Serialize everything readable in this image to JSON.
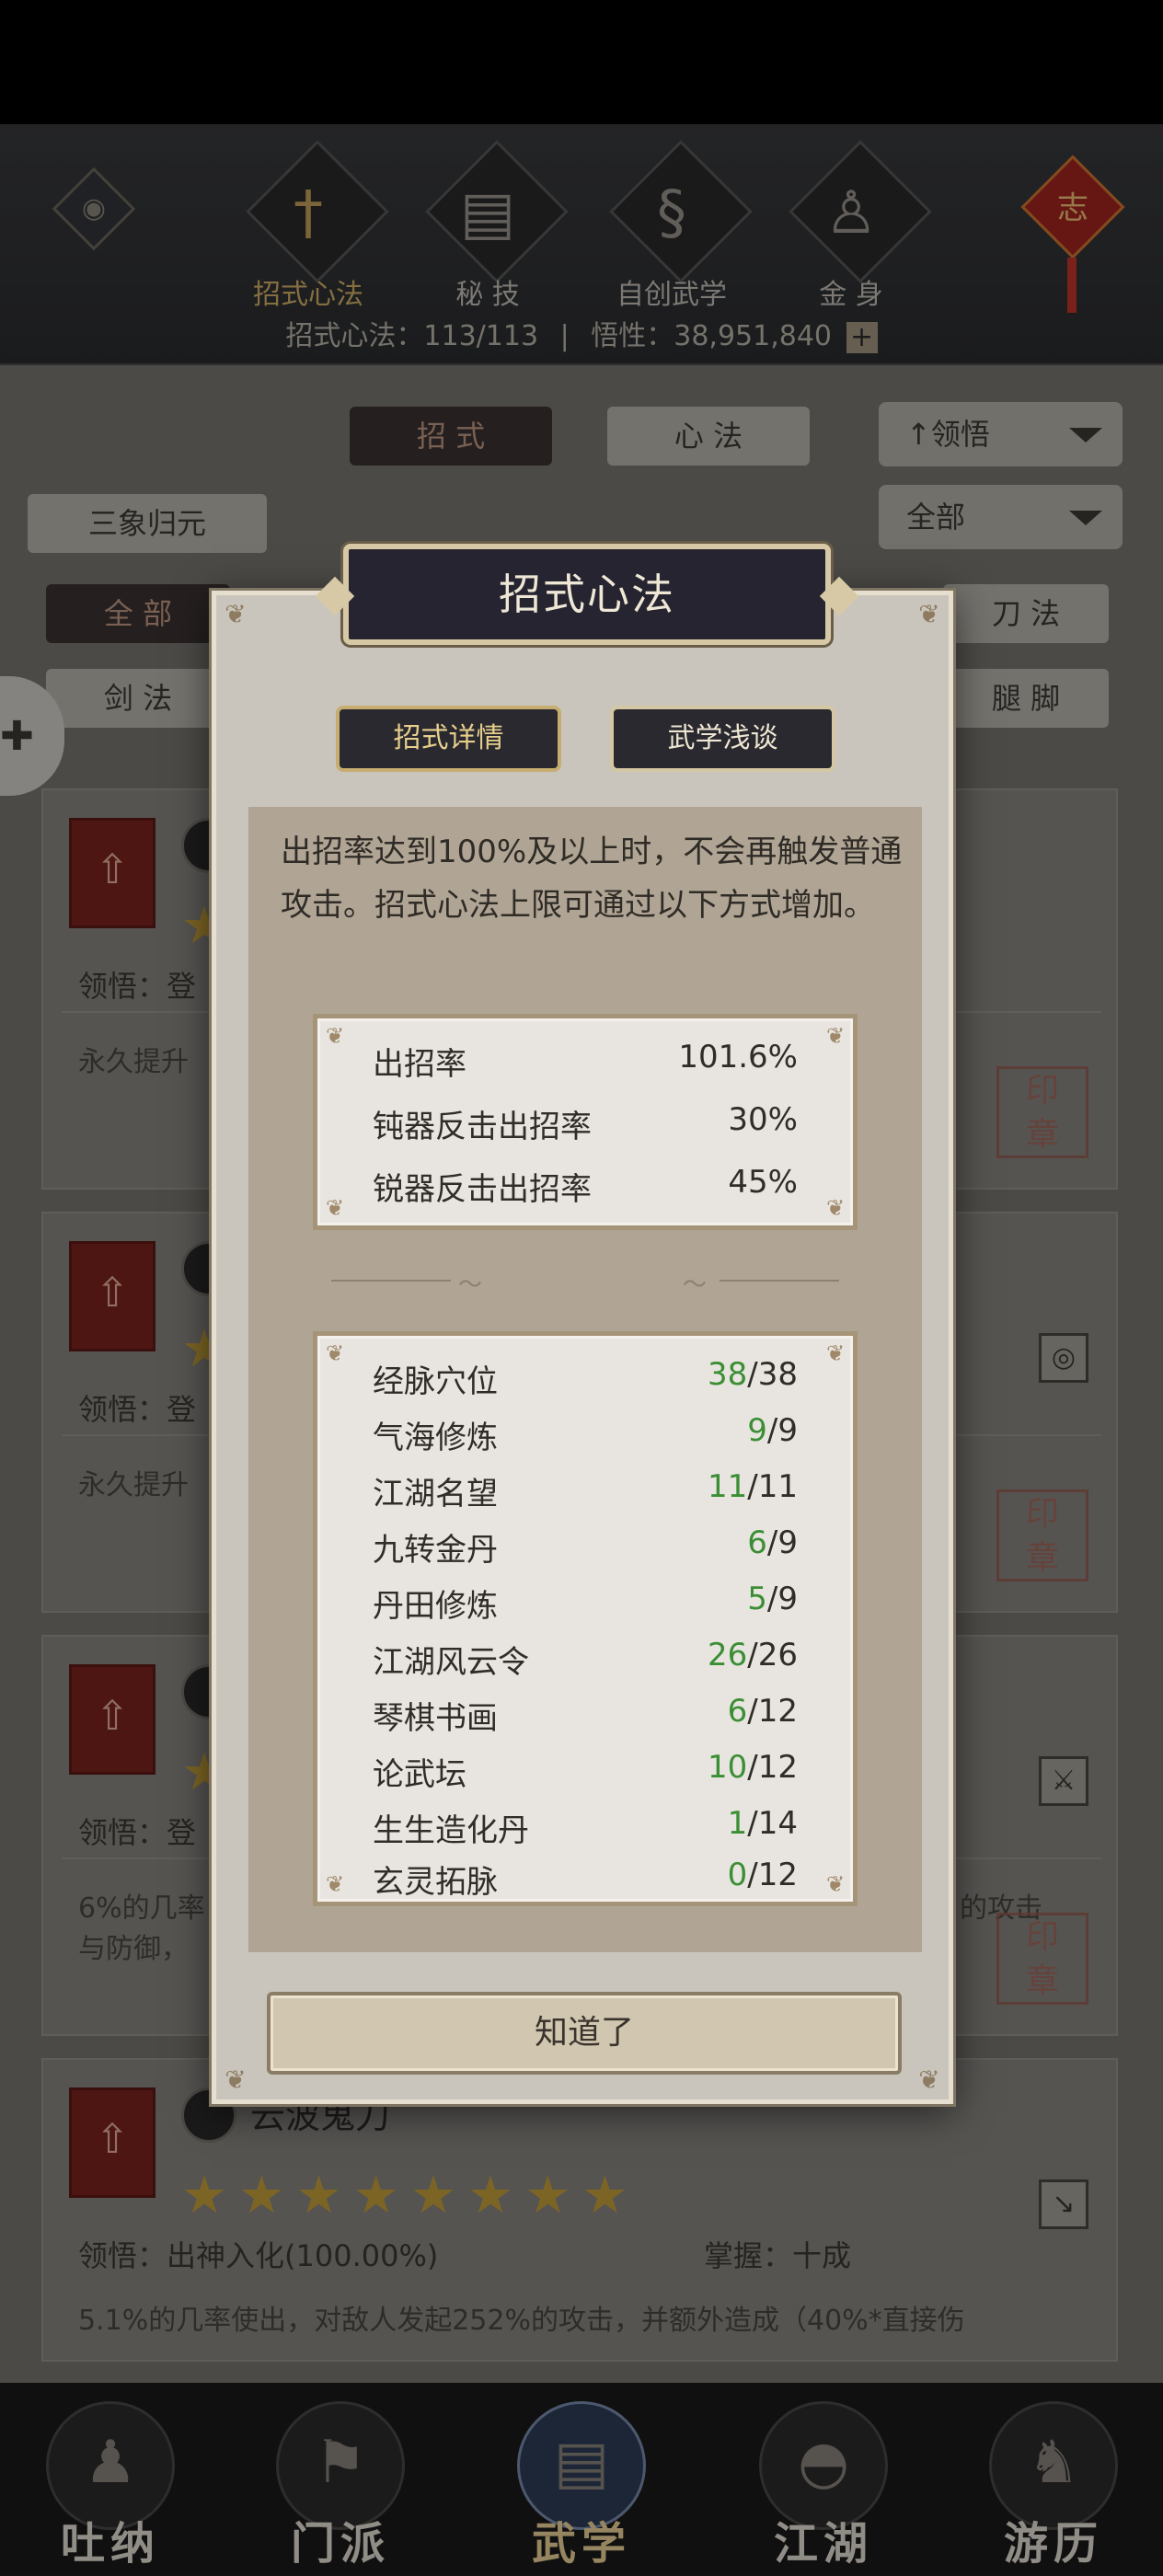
{
  "topnav": {
    "tabs": [
      {
        "label": "招式心法",
        "icon": "sword-icon"
      },
      {
        "label": "秘 技",
        "icon": "book-icon"
      },
      {
        "label": "自创武学",
        "icon": "scroll-icon"
      },
      {
        "label": "金 身",
        "icon": "meditation-icon"
      }
    ],
    "knot_text": "志",
    "stat_left": "招式心法：113/113",
    "stat_sep": "|",
    "stat_right": "悟性：38,951,840",
    "plus": "+"
  },
  "filters": {
    "tab_zhaoshi": "招 式",
    "tab_xinfa": "心 法",
    "sort_select": "领悟",
    "search_value": "三象归元",
    "category_select": "全部",
    "chips": [
      "全 部",
      "刀 法",
      "剑 法",
      "腿 脚"
    ]
  },
  "cards": [
    {
      "row_label": "领悟：登",
      "desc": "永久提升"
    },
    {
      "row_label": "领悟：登",
      "desc": "永久提升"
    },
    {
      "row_label": "领悟：登",
      "desc": "6%的几率",
      "desc2": "与防御，",
      "desc_right": "的攻击"
    },
    {
      "title": "云波鬼刀",
      "row_label": "领悟：出神入化(100.00%)",
      "row_right": "掌握：十成",
      "desc": "5.1%的几率使出，对敌人发起252%的攻击，并额外造成（40%*直接伤",
      "stars": 8
    }
  ],
  "bottombar": [
    {
      "label": "吐纳"
    },
    {
      "label": "门派"
    },
    {
      "label": "武学"
    },
    {
      "label": "江湖"
    },
    {
      "label": "游历"
    }
  ],
  "modal": {
    "title": "招式心法",
    "tab_detail": "招式详情",
    "tab_talk": "武学浅谈",
    "description": "出招率达到100%及以上时，不会再触发普通攻击。招式心法上限可通过以下方式增加。",
    "rates": [
      {
        "label": "出招率",
        "value": "101.6%"
      },
      {
        "label": "钝器反击出招率",
        "value": "30%"
      },
      {
        "label": "锐器反击出招率",
        "value": "45%"
      }
    ],
    "sources": [
      {
        "label": "经脉穴位",
        "current": "38",
        "max": "/38"
      },
      {
        "label": "气海修炼",
        "current": "9",
        "max": "/9"
      },
      {
        "label": "江湖名望",
        "current": "11",
        "max": "/11"
      },
      {
        "label": "九转金丹",
        "current": "6",
        "max": "/9"
      },
      {
        "label": "丹田修炼",
        "current": "5",
        "max": "/9"
      },
      {
        "label": "江湖风云令",
        "current": "26",
        "max": "/26"
      },
      {
        "label": "琴棋书画",
        "current": "6",
        "max": "/12"
      },
      {
        "label": "论武坛",
        "current": "10",
        "max": "/12"
      },
      {
        "label": "生生造化丹",
        "current": "1",
        "max": "/14"
      },
      {
        "label": "玄灵拓脉",
        "current": "0",
        "max": "/12"
      }
    ],
    "ok_label": "知道了"
  },
  "colors": {
    "accent_green": "#3b8e34",
    "modal_bg": "#cac5bc",
    "title_plate": "#252430"
  }
}
